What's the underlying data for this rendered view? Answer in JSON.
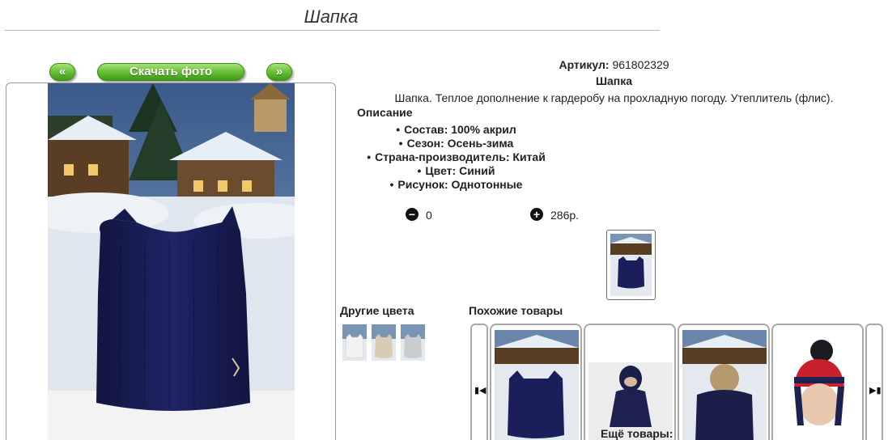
{
  "page": {
    "title": "Шапка"
  },
  "gallery": {
    "prev_label": "«",
    "download_label": "Скачать фото",
    "next_label": "»"
  },
  "product": {
    "article_label": "Артикул:",
    "article_value": "961802329",
    "name": "Шапка",
    "description": "Шапка. Теплое дополнение к гардеробу на прохладную погоду. Утеплитель (флис).",
    "description_heading": "Описание",
    "features": [
      "Состав: 100% акрил",
      "Сезон: Осень-зима",
      "Страна-производитель: Китай",
      "Цвет: Синий",
      "Рисунок: Однотонные"
    ]
  },
  "cart": {
    "minus_icon": "minus-circle-icon",
    "plus_icon": "plus-circle-icon",
    "quantity": "0",
    "price": "286р."
  },
  "other_colors": {
    "title": "Другие цвета",
    "swatch_colors": [
      "#f2f2f2",
      "#d8ccb6",
      "#c9cccf"
    ]
  },
  "similar": {
    "title": "Похожие товары",
    "prev_icon": "skip-previous-icon",
    "next_icon": "skip-next-icon"
  },
  "more": {
    "title": "Ещё товары:"
  },
  "colors": {
    "button_green": "#6cc23b",
    "hat_navy": "#1a1f5c",
    "frame_gray": "#9a9a9a"
  }
}
